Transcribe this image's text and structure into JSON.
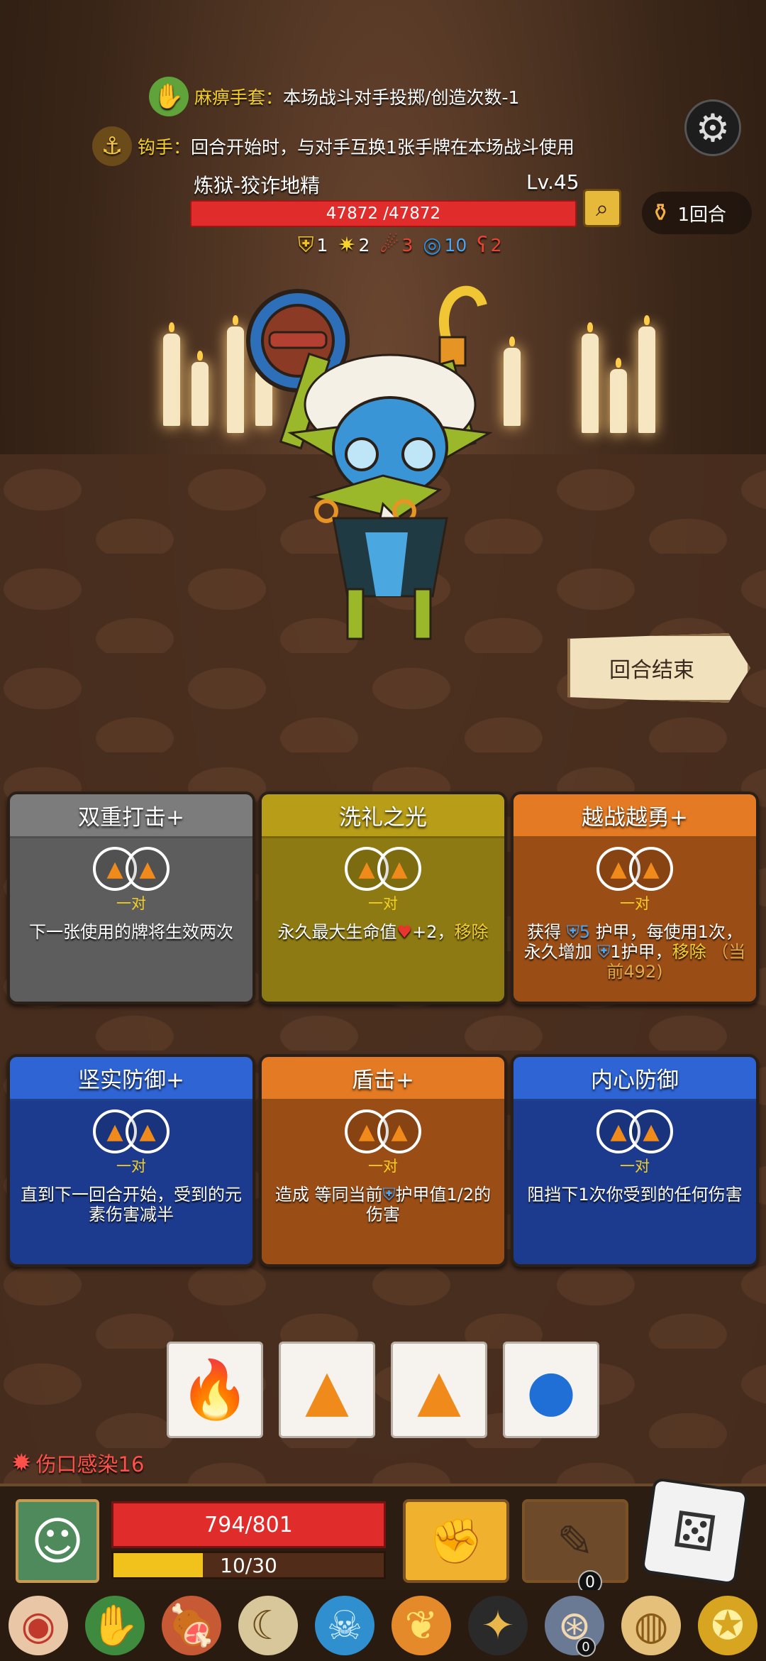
{
  "relics_header": [
    {
      "icon": "green-glove-icon",
      "name": "麻痹手套：",
      "desc": "本场战斗对手投掷/创造次数-1"
    },
    {
      "icon": "hook-icon",
      "name": "钩手：",
      "desc": "回合开始时，与对手互换1张手牌在本场战斗使用"
    }
  ],
  "enemy": {
    "name": "炼狱-狡诈地精",
    "level": "Lv.45",
    "hp_text": "47872 /47872",
    "statuses": [
      {
        "icon": "shield-icon",
        "value": "1",
        "color": "#f2c21c"
      },
      {
        "icon": "spark-icon",
        "value": "2",
        "color": "#f6d22b"
      },
      {
        "icon": "blood-drop-icon",
        "value": "3",
        "color": "#e8442f"
      },
      {
        "icon": "swirl-icon",
        "value": "10",
        "color": "#2d95e8"
      },
      {
        "icon": "claw-icon",
        "value": "2",
        "color": "#e8442f"
      }
    ]
  },
  "round": {
    "label": "1回合"
  },
  "end_turn": {
    "label": "回合结束"
  },
  "cards": [
    {
      "title": "双重打击+",
      "pair": "一对",
      "desc": "下一张使用的牌将生效两次",
      "theme": "grey"
    },
    {
      "title": "洗礼之光",
      "pair": "一对",
      "desc_a": "永久最大生命值",
      "desc_b": "+2，",
      "desc_hl": "移除",
      "theme": "olive"
    },
    {
      "title": "越战越勇+",
      "pair": "一对",
      "desc_a": "获得",
      "desc_b": "5",
      "desc_c": "护甲，每使用1次，永久增加",
      "desc_d": "1护甲，",
      "desc_hl": "移除",
      "desc_e": "（当前492)",
      "theme": "orange"
    },
    {
      "title": "坚实防御+",
      "pair": "一对",
      "desc": "直到下一回合开始，受到的元素伤害减半",
      "theme": "blue"
    },
    {
      "title": "盾击+",
      "pair": "一对",
      "desc_a": "造成 等同当前",
      "desc_b": "护甲值1/2的伤害",
      "theme": "orange"
    },
    {
      "title": "内心防御",
      "pair": "一对",
      "desc": "阻挡下1次你受到的任何伤害",
      "theme": "blue"
    }
  ],
  "dice_pool": [
    {
      "icon": "fire-icon",
      "color": "#e4312a"
    },
    {
      "icon": "earth-rock-icon",
      "color": "#f08a1a"
    },
    {
      "icon": "earth-rock-icon",
      "color": "#f08a1a"
    },
    {
      "icon": "water-drop-icon",
      "color": "#1f6fd6"
    }
  ],
  "player": {
    "debuff": "伤口感染16",
    "hp_text": "794/801",
    "energy_text": "10/30",
    "energy_fraction": 0.33,
    "skill2_count": "0"
  }
}
